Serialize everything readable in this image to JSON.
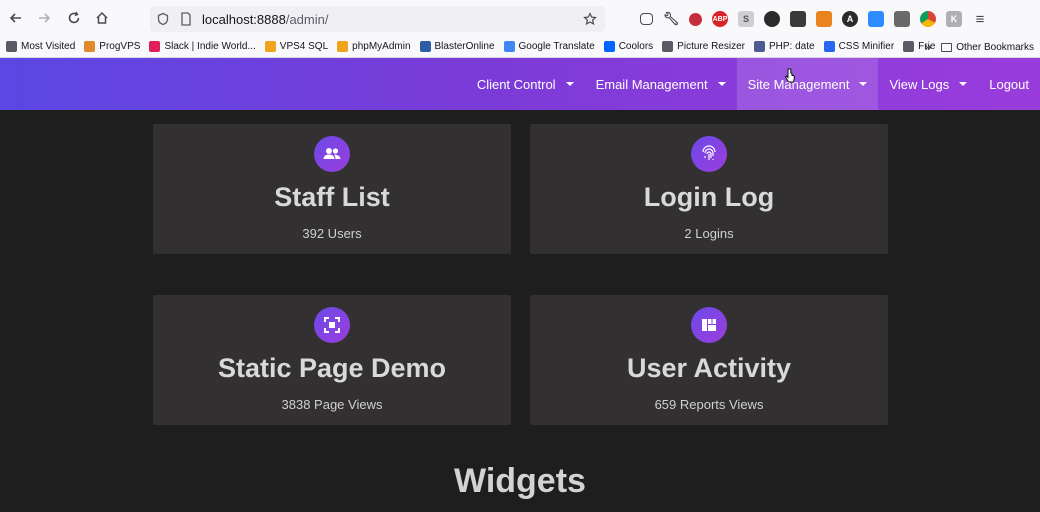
{
  "browser": {
    "url_host": "localhost:8888",
    "url_path": "/admin/",
    "bookmarks": [
      {
        "label": "Most Visited",
        "color": "#5b5b66"
      },
      {
        "label": "ProgVPS",
        "color": "#e08a2b"
      },
      {
        "label": "Slack | Indie World...",
        "color": "#e01e5a"
      },
      {
        "label": "VPS4 SQL",
        "color": "#f0a31c"
      },
      {
        "label": "phpMyAdmin",
        "color": "#f0a31c"
      },
      {
        "label": "BlasterOnline",
        "color": "#2b5ea7"
      },
      {
        "label": "Google Translate",
        "color": "#4285f4"
      },
      {
        "label": "Coolors",
        "color": "#0066ff"
      },
      {
        "label": "Picture Resizer",
        "color": "#5b5b66"
      },
      {
        "label": "PHP: date",
        "color": "#4f5b93"
      },
      {
        "label": "CSS Minifier",
        "color": "#2965f1"
      },
      {
        "label": "Frie",
        "color": "#5b5b66"
      }
    ],
    "other_bookmarks": "Other Bookmarks"
  },
  "nav": {
    "items": [
      {
        "label": "Client Control",
        "has_caret": true
      },
      {
        "label": "Email Management",
        "has_caret": true
      },
      {
        "label": "Site Management",
        "has_caret": true,
        "active": true
      },
      {
        "label": "View Logs",
        "has_caret": true
      },
      {
        "label": "Logout",
        "has_caret": false
      }
    ]
  },
  "cards": [
    {
      "title": "Staff List",
      "sub": "392 Users",
      "icon": "people-icon"
    },
    {
      "title": "Login Log",
      "sub": "2 Logins",
      "icon": "fingerprint-icon"
    },
    {
      "title": "Static Page Demo",
      "sub": "3838 Page Views",
      "icon": "fullscreen-icon"
    },
    {
      "title": "User Activity",
      "sub": "659 Reports Views",
      "icon": "dashboard-icon"
    }
  ],
  "widgets_heading": "Widgets",
  "colors": {
    "nav_gradient_start": "#5b47e3",
    "nav_gradient_end": "#9a3cdc",
    "card_bg": "#333031",
    "page_bg": "#1e1e1e"
  }
}
